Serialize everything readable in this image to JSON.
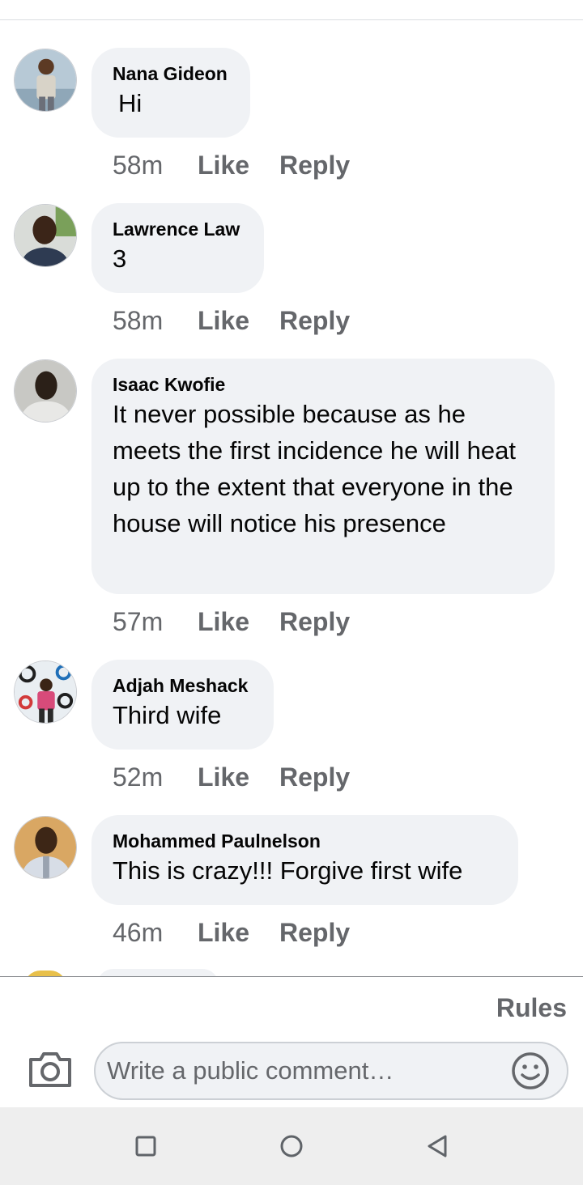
{
  "comments": [
    {
      "author": "Nana Gideon",
      "text": "Hi",
      "time": "58m",
      "like": "Like",
      "reply": "Reply"
    },
    {
      "author": "Lawrence Law",
      "text": "3",
      "time": "58m",
      "like": "Like",
      "reply": "Reply"
    },
    {
      "author": "Isaac Kwofie",
      "text": "It never possible because as he meets the first incidence he will heat up to the extent that everyone in the house will notice his presence",
      "time": "57m",
      "like": "Like",
      "reply": "Reply"
    },
    {
      "author": "Adjah Meshack",
      "text": "Third wife",
      "time": "52m",
      "like": "Like",
      "reply": "Reply"
    },
    {
      "author": "Mohammed Paulnelson",
      "text": "This is crazy!!! Forgive first wife",
      "time": "46m",
      "like": "Like",
      "reply": "Reply"
    }
  ],
  "composer": {
    "rules_label": "Rules",
    "placeholder": "Write a public comment…",
    "camera_icon": "camera-icon",
    "emoji_icon": "emoji-icon"
  },
  "navigation": {
    "recents_icon": "square-icon",
    "home_icon": "circle-icon",
    "back_icon": "triangle-back-icon"
  },
  "colors": {
    "bubble": "#f0f2f5",
    "meta_text": "#65676b",
    "primary_text": "#050505"
  }
}
